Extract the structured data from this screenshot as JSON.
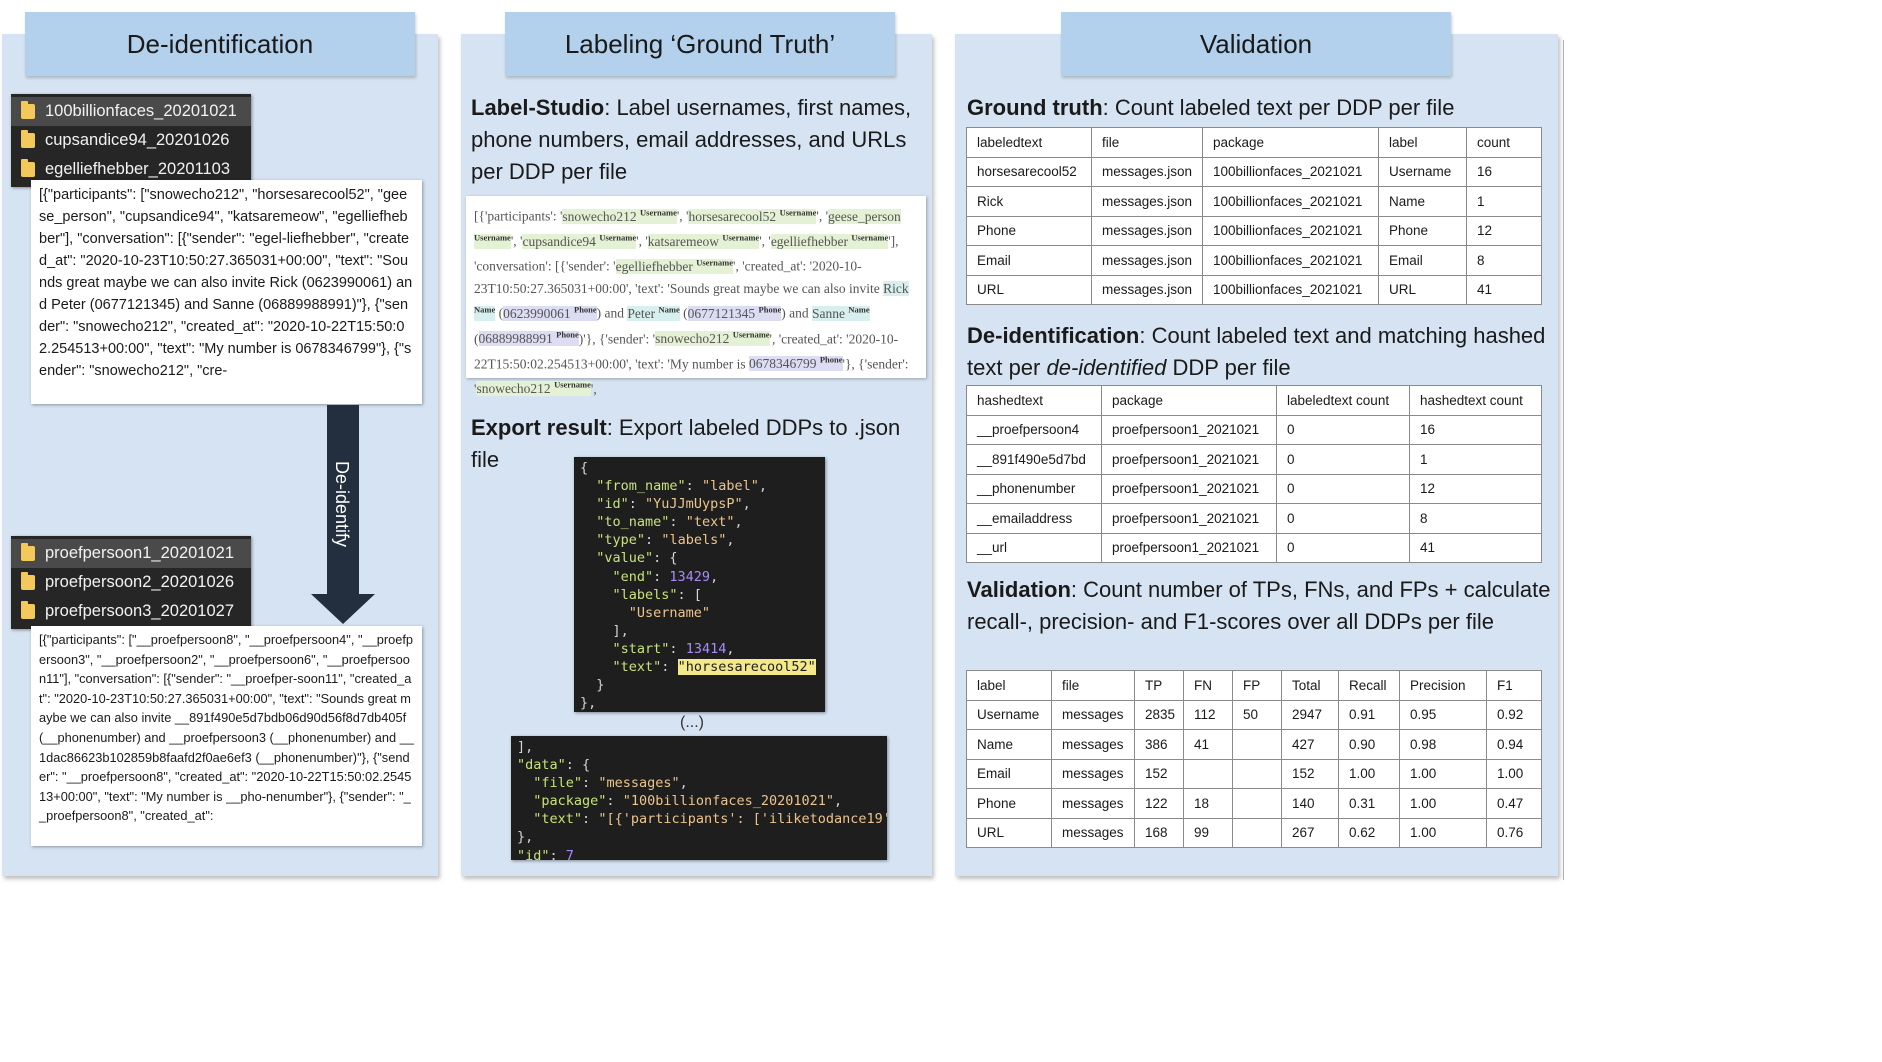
{
  "panels": {
    "deid": {
      "title": "De-identification"
    },
    "label": {
      "title": "Labeling ‘Ground Truth’"
    },
    "valid": {
      "title": "Validation"
    }
  },
  "deid": {
    "original_folders": [
      "100billionfaces_20201021",
      "cupsandice94_20201026",
      "egelliefhebber_20201103"
    ],
    "original_text": "[{\"participants\": [\"snowecho212\", \"horsesarecool52\", \"geese_person\", \"cupsandice94\", \"katsaremeow\", \"egelliefhebber\"], \"conversation\": [{\"sender\": \"egel-liefhebber\", \"created_at\": \"2020-10-23T10:50:27.365031+00:00\", \"text\": \"Sounds great maybe we can also invite Rick (0623990061) and Peter (0677121345) and Sanne (06889988991)\"}, {\"sender\": \"snowecho212\", \"created_at\": \"2020-10-22T15:50:02.254513+00:00\", \"text\": \"My number is 0678346799\"}, {\"sender\": \"snowecho212\", \"cre-",
    "arrow_label": "De-identify",
    "deid_folders": [
      "proefpersoon1_20201021",
      "proefpersoon2_20201026",
      "proefpersoon3_20201027"
    ],
    "deid_text": "[{\"participants\": [\"__proefpersoon8\", \"__proefpersoon4\", \"__proefpersoon3\", \"__proefpersoon2\", \"__proefpersoon6\", \"__proefpersoon11\"], \"conversation\": [{\"sender\": \"__proefper-soon11\", \"created_at\": \"2020-10-23T10:50:27.365031+00:00\", \"text\": \"Sounds great maybe we can also invite __891f490e5d7bdb06d90d56f8d7db405f (__phonenumber) and __proefpersoon3 (__phonenumber) and __1dac86623b102859b8faafd2f0ae6ef3 (__phonenumber)\"}, {\"sender\": \"__proefpersoon8\", \"created_at\": \"2020-10-22T15:50:02.254513+00:00\", \"text\": \"My number is __pho-nenumber\"}, {\"sender\": \"__proefpersoon8\", \"created_at\":"
  },
  "labeling": {
    "ls_bold": "Label-Studio",
    "ls_text": ":  Label usernames, first names, phone numbers, email addresses, and URLs per DDP per file",
    "export_bold": "Export result",
    "export_text": ": Export labeled DDPs to .json file",
    "ellipsis": "(...)",
    "tags": {
      "username": "Username",
      "name": "Name",
      "phone": "Phone"
    }
  },
  "validation": {
    "gt_bold": "Ground truth",
    "gt_text": ": Count labeled text per DDP per file",
    "gt_table": {
      "headers": [
        "labeledtext",
        "file",
        "package",
        "label",
        "count"
      ],
      "rows": [
        [
          "horsesarecool52",
          "messages.json",
          "100billionfaces_2021021",
          "Username",
          "16"
        ],
        [
          "Rick",
          "messages.json",
          "100billionfaces_2021021",
          "Name",
          "1"
        ],
        [
          "Phone",
          "messages.json",
          "100billionfaces_2021021",
          "Phone",
          "12"
        ],
        [
          "Email",
          "messages.json",
          "100billionfaces_2021021",
          "Email",
          "8"
        ],
        [
          "URL",
          "messages.json",
          "100billionfaces_2021021",
          "URL",
          "41"
        ]
      ]
    },
    "di_bold": "De-identification",
    "di_text_1": ":  Count labeled text and matching hashed text per ",
    "di_italic": "de-identified",
    "di_text_2": " DDP per file",
    "di_table": {
      "headers": [
        "hashedtext",
        "package",
        "labeledtext count",
        "hashedtext count"
      ],
      "rows": [
        [
          "__proefpersoon4",
          "proefpersoon1_2021021",
          "0",
          "16"
        ],
        [
          "__891f490e5d7bd",
          "proefpersoon1_2021021",
          "0",
          "1"
        ],
        [
          "__phonenumber",
          "proefpersoon1_2021021",
          "0",
          "12"
        ],
        [
          "__emailaddress",
          "proefpersoon1_2021021",
          "0",
          "8"
        ],
        [
          "__url",
          "proefpersoon1_2021021",
          "0",
          "41"
        ]
      ]
    },
    "val_bold": "Validation",
    "val_text": ":  Count number of TPs, FNs, and FPs + calculate recall-, precision- and F1-scores over all DDPs per file",
    "val_table": {
      "headers": [
        "label",
        "file",
        "TP",
        "FN",
        "FP",
        "Total",
        "Recall",
        "Precision",
        "F1"
      ],
      "rows": [
        [
          "Username",
          "messages",
          "2835",
          "112",
          "50",
          "2947",
          "0.91",
          "0.95",
          "0.92"
        ],
        [
          "Name",
          "messages",
          "386",
          "41",
          "",
          "427",
          "0.90",
          "0.98",
          "0.94"
        ],
        [
          "Email",
          "messages",
          "152",
          "",
          "",
          "152",
          "1.00",
          "1.00",
          "1.00"
        ],
        [
          "Phone",
          "messages",
          "122",
          "18",
          "",
          "140",
          "0.31",
          "1.00",
          "0.47"
        ],
        [
          "URL",
          "messages",
          "168",
          "99",
          "",
          "267",
          "0.62",
          "1.00",
          "0.76"
        ]
      ]
    }
  }
}
